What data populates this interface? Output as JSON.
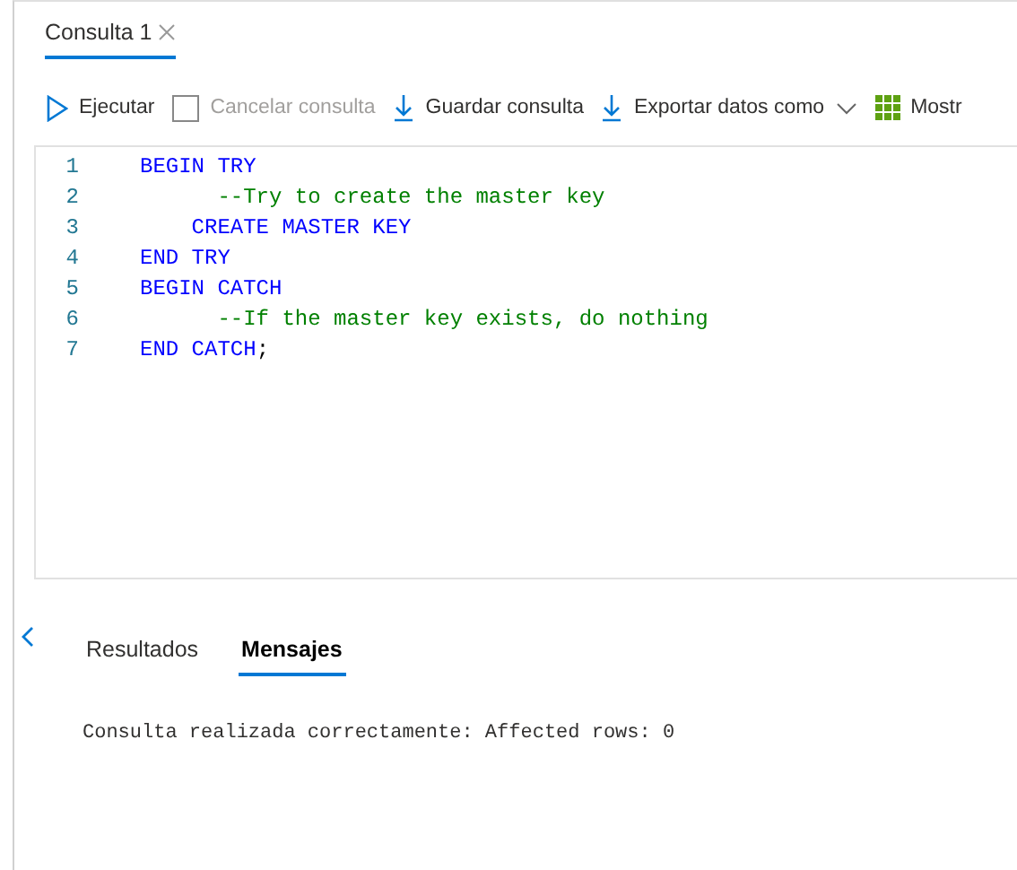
{
  "tabs": [
    {
      "label": "Consulta 1",
      "selected": true
    }
  ],
  "toolbar": [
    {
      "kind": "run",
      "label": "Ejecutar",
      "disabled": false
    },
    {
      "kind": "stop",
      "label": "Cancelar consulta",
      "disabled": true
    },
    {
      "kind": "download",
      "label": "Guardar consulta",
      "disabled": false
    },
    {
      "kind": "export",
      "label": "Exportar datos como",
      "disabled": false
    },
    {
      "kind": "grid",
      "label": "Mostr",
      "disabled": false
    }
  ],
  "editor": {
    "lines": [
      {
        "number": "1",
        "tokens": [
          {
            "kind": "keyword",
            "text": "BEGIN TRY"
          }
        ]
      },
      {
        "number": "2",
        "tokens": [
          {
            "kind": "comment",
            "text": "      --Try to create the master key"
          }
        ]
      },
      {
        "number": "3",
        "tokens": [
          {
            "kind": "keyword",
            "text": "    CREATE MASTER KEY"
          }
        ]
      },
      {
        "number": "4",
        "tokens": [
          {
            "kind": "keyword",
            "text": "END TRY"
          }
        ]
      },
      {
        "number": "5",
        "tokens": [
          {
            "kind": "keyword",
            "text": "BEGIN CATCH"
          }
        ]
      },
      {
        "number": "6",
        "tokens": [
          {
            "kind": "comment",
            "text": "      --If the master key exists, do nothing"
          }
        ]
      },
      {
        "number": "7",
        "tokens": [
          {
            "kind": "keyword",
            "text": "END CATCH"
          },
          {
            "kind": "punct",
            "text": ";"
          }
        ]
      }
    ]
  },
  "result_tabs": [
    {
      "label": "Resultados",
      "selected": false
    },
    {
      "label": "Mensajes",
      "selected": true
    }
  ],
  "message": "Consulta realizada correctamente: Affected rows: 0"
}
